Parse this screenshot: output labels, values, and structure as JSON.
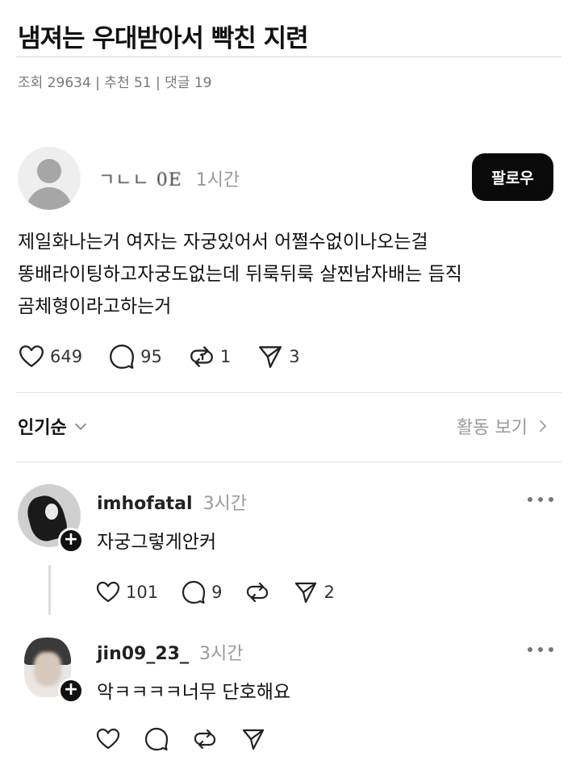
{
  "post": {
    "title": "냄져는 우대받아서 빡친  지련",
    "meta": "조회 29634 | 추천 51 | 댓글 19"
  },
  "thread": {
    "author_name": "ㄱㄴㄴ  0E",
    "time": "1시간",
    "follow_label": "팔로우",
    "body_lines": [
      "제일화나는거 여자는 자궁있어서 어쩔수없이나오는걸",
      "똥배라이팅하고자궁도없는데 뒤룩뒤룩 살찐남자배는 듬직",
      "곰체형이라고하는거"
    ],
    "likes": "649",
    "comments": "95",
    "reposts": "1",
    "shares": "3"
  },
  "sort": {
    "label": "인기순",
    "activity_label": "활동 보기"
  },
  "replies": [
    {
      "username": "imhofatal",
      "time": "3시간",
      "text": "자궁그렇게안커",
      "likes": "101",
      "comments": "9",
      "reposts": "",
      "shares": "2"
    },
    {
      "username": "jin09_23_",
      "time": "3시간",
      "text": "악ㅋㅋㅋㅋ너무 단호해요",
      "likes": "",
      "comments": "",
      "reposts": "",
      "shares": ""
    }
  ],
  "icons": {
    "avatar_default": "person-silhouette-icon",
    "like": "heart-icon",
    "comment": "speech-bubble-icon",
    "repost": "repost-arrows-icon",
    "share": "paper-plane-icon",
    "more": "more-dots-icon",
    "follow_badge": "plus-icon",
    "sort": "chevron-down-icon",
    "activity": "chevron-right-icon"
  },
  "colors": {
    "follow_button": "#0a0a0a",
    "meta_text": "#777777"
  }
}
